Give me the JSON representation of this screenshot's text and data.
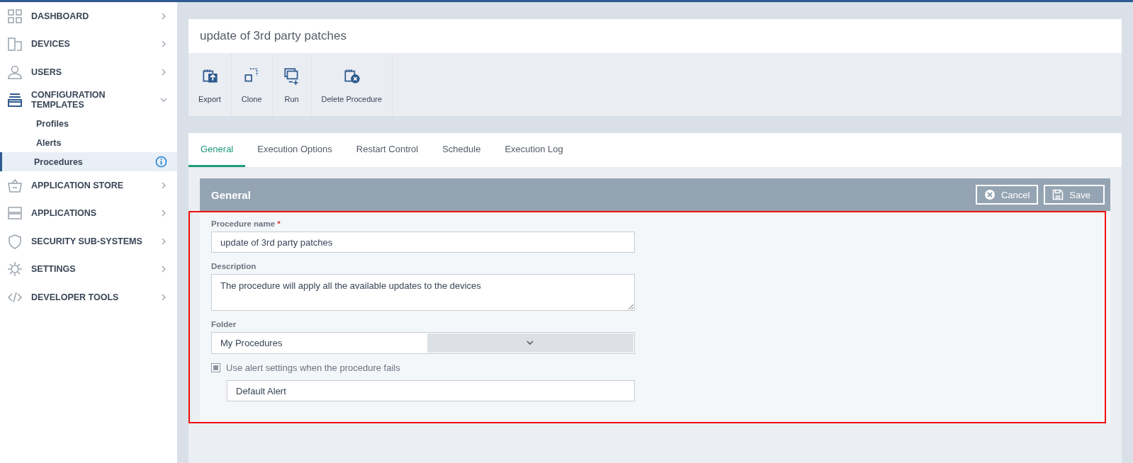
{
  "sidebar": {
    "items": [
      {
        "label": "DASHBOARD",
        "expanded": false
      },
      {
        "label": "DEVICES",
        "expanded": false
      },
      {
        "label": "USERS",
        "expanded": false
      },
      {
        "label": "CONFIGURATION TEMPLATES",
        "expanded": true,
        "children": [
          {
            "label": "Profiles",
            "selected": false
          },
          {
            "label": "Alerts",
            "selected": false
          },
          {
            "label": "Procedures",
            "selected": true
          }
        ]
      },
      {
        "label": "APPLICATION STORE",
        "expanded": false
      },
      {
        "label": "APPLICATIONS",
        "expanded": false
      },
      {
        "label": "SECURITY SUB-SYSTEMS",
        "expanded": false
      },
      {
        "label": "SETTINGS",
        "expanded": false
      },
      {
        "label": "DEVELOPER TOOLS",
        "expanded": false
      }
    ]
  },
  "page_title": "update of 3rd party patches",
  "toolbar": [
    {
      "label": "Export"
    },
    {
      "label": "Clone"
    },
    {
      "label": "Run"
    },
    {
      "label": "Delete Procedure"
    }
  ],
  "tabs": [
    {
      "label": "General",
      "selected": true
    },
    {
      "label": "Execution Options",
      "selected": false
    },
    {
      "label": "Restart Control",
      "selected": false
    },
    {
      "label": "Schedule",
      "selected": false
    },
    {
      "label": "Execution Log",
      "selected": false
    }
  ],
  "section": {
    "title": "General",
    "buttons": [
      {
        "label": "Cancel",
        "kind": "cancel"
      },
      {
        "label": "Save",
        "kind": "save"
      }
    ]
  },
  "form": {
    "name_label": "Procedure name",
    "name_required_mark": "*",
    "name_value": "update of 3rd party patches",
    "description_label": "Description",
    "description_value": "The procedure will apply all the available updates to the devices",
    "folder_label": "Folder",
    "folder_value": "My Procedures",
    "alert_checkbox": {
      "label": "Use alert settings when the procedure fails",
      "checked": true
    },
    "alert_value": "Default Alert"
  }
}
